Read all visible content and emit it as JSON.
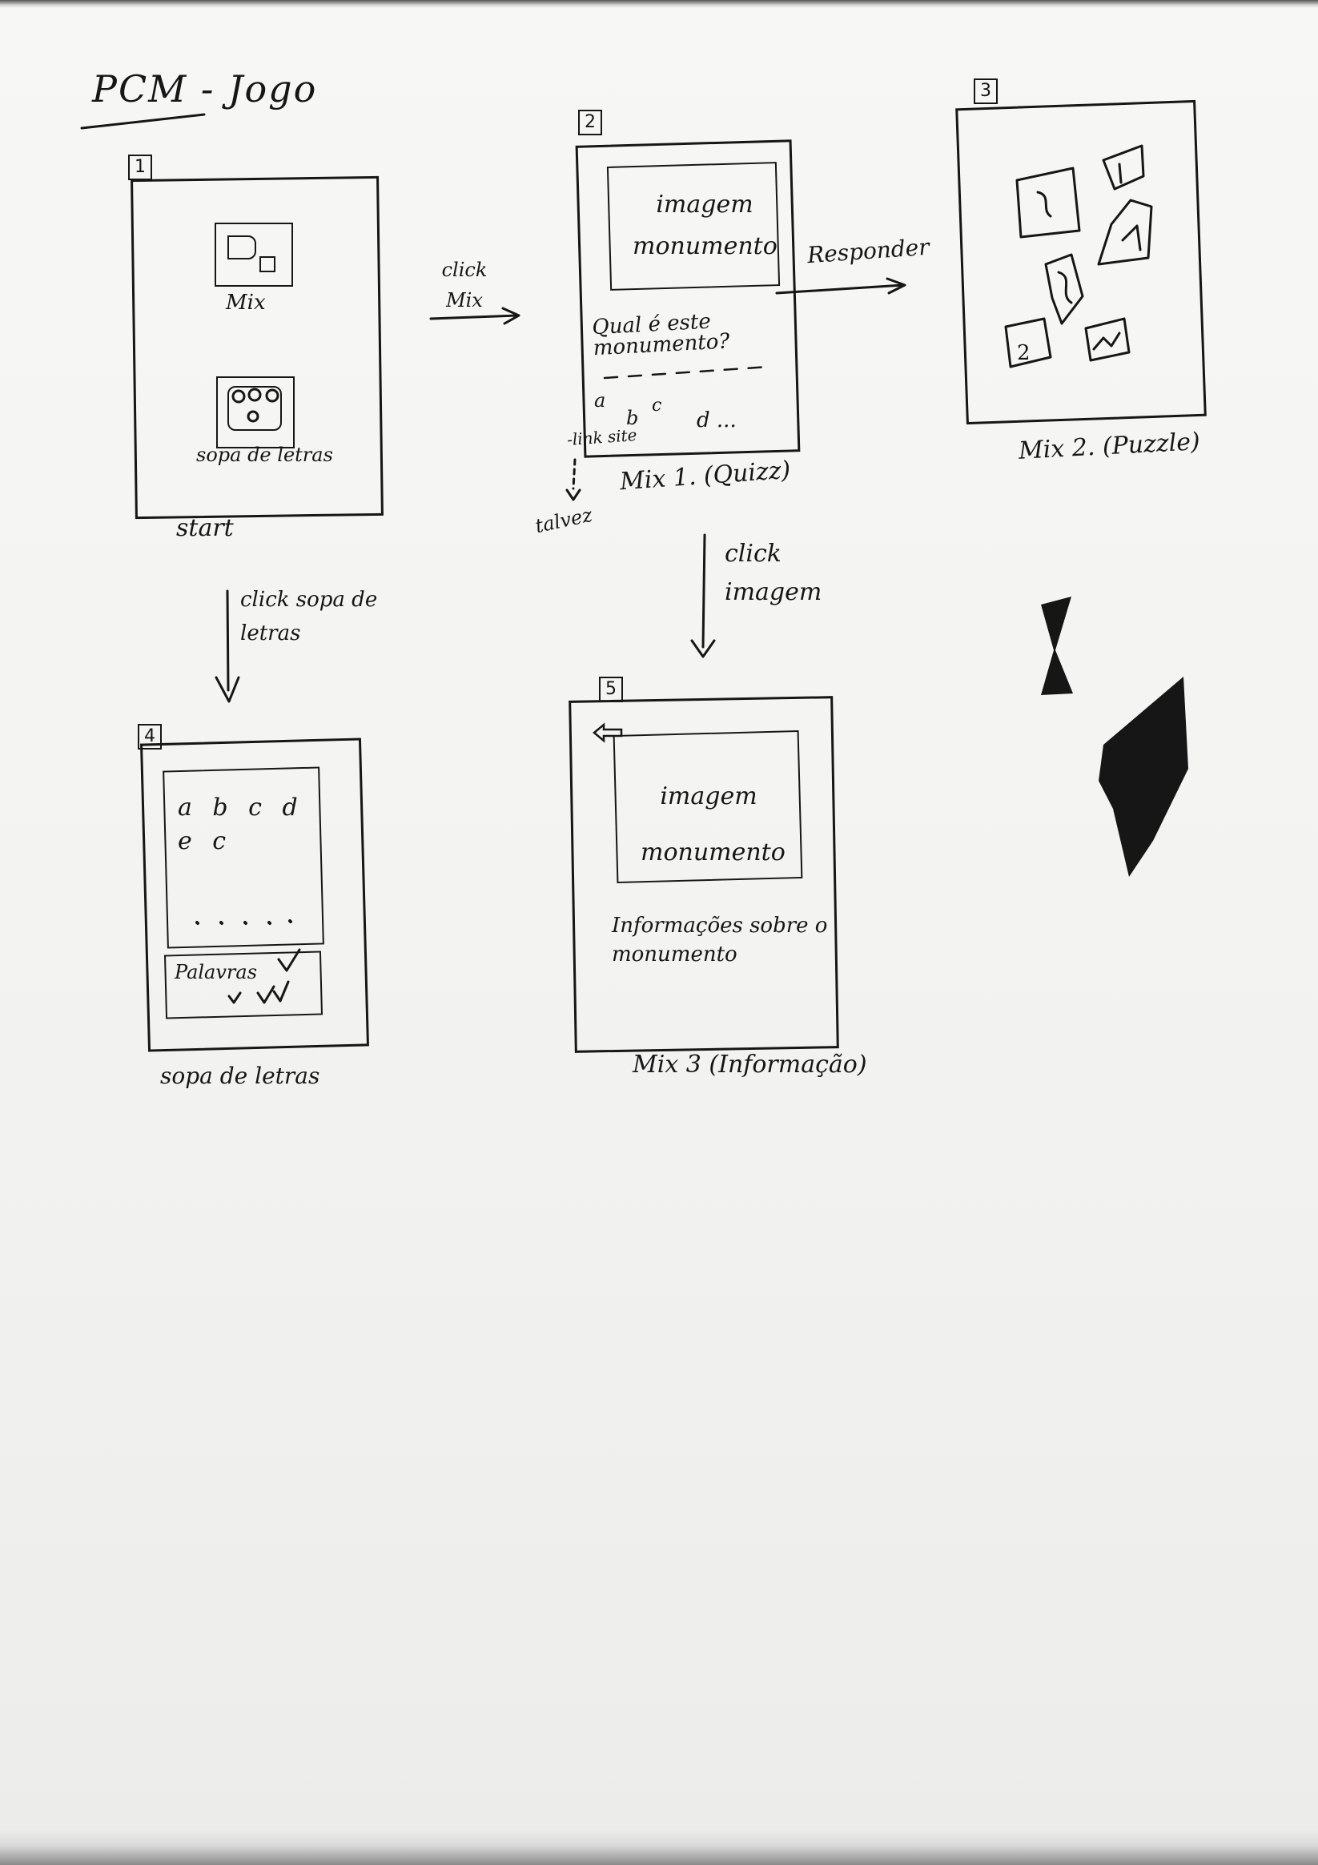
{
  "title": "PCM - Jogo",
  "screens": [
    {
      "number": "1",
      "caption": "start",
      "buttons": [
        "Mix",
        "sopa de letras"
      ]
    },
    {
      "number": "2",
      "caption": "Mix 1. (Quizz)",
      "image_label": "imagem monumento",
      "question": "Qual é este monumento?",
      "options": [
        "a",
        "b",
        "c",
        "d ..."
      ],
      "link": "-link site",
      "note": "talvez"
    },
    {
      "number": "3",
      "caption": "Mix 2. (Puzzle)",
      "piece_label": "2"
    },
    {
      "number": "4",
      "caption": "sopa de letras",
      "letters": "a b c d e c",
      "words_label": "Palavras"
    },
    {
      "number": "5",
      "caption": "Mix 3 (Informação)",
      "image_label": "imagem monumento",
      "info": "Informações sobre o monumento"
    }
  ],
  "transitions": [
    {
      "label": "click Mix"
    },
    {
      "label": "Responder"
    },
    {
      "label": "click sopa de letras"
    },
    {
      "label": "click imagem"
    }
  ]
}
